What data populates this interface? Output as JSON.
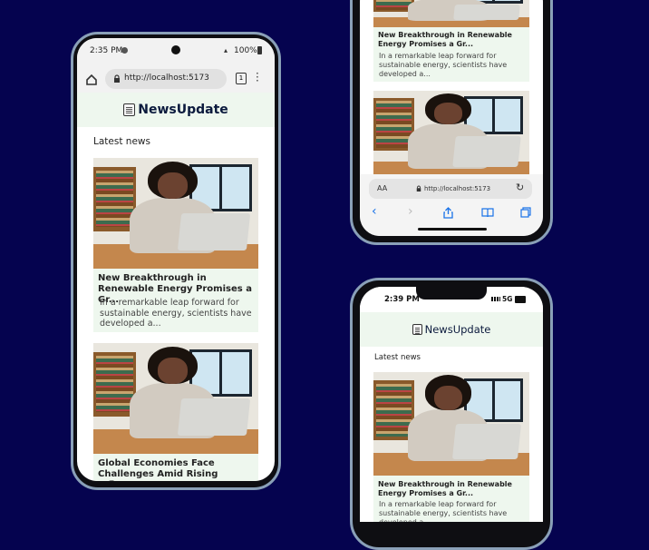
{
  "colors": {
    "background": "#05034f",
    "header_bg": "#eef7ee",
    "brand": "#0b1a3d",
    "ios_blue": "#1a73e8"
  },
  "site": {
    "logo_icon": "newspaper-icon",
    "title": "NewsUpdate",
    "section_title": "Latest news"
  },
  "articles": [
    {
      "title": "New Breakthrough in Renewable Energy Promises a Gr...",
      "description": "In a remarkable leap forward for sustainable energy, scientists have developed a..."
    },
    {
      "title": "Global Economies Face Challenges Amid Rising Infla..."
    }
  ],
  "android": {
    "status_time": "2:35 PM",
    "battery": "100%",
    "url": "http://localhost:5173",
    "tab_count": "1"
  },
  "iphone_top": {
    "text_size": "AA",
    "url": "http://localhost:5173"
  },
  "iphone_bottom": {
    "status_time": "2:39 PM",
    "network": "5G"
  }
}
